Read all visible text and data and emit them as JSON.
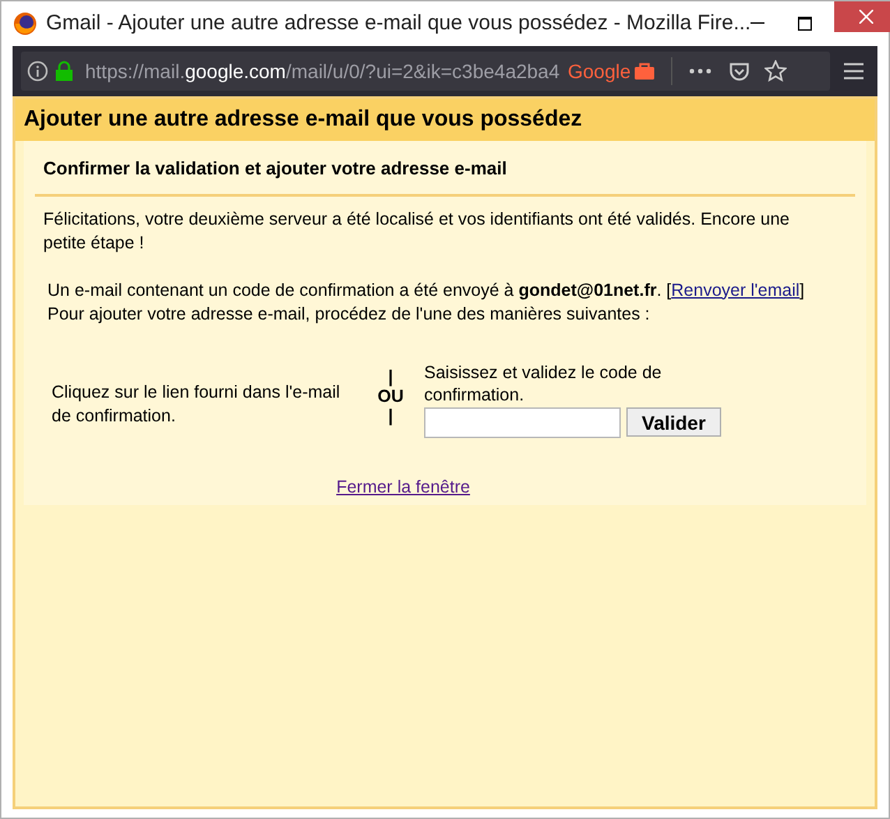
{
  "window": {
    "title": "Gmail - Ajouter une autre adresse e-mail que vous possédez - Mozilla Fire..."
  },
  "toolbar": {
    "url_prefix": "https://mail.",
    "url_domain": "google.com",
    "url_rest": "/mail/u/0/?ui=2&ik=c3be4a2ba4",
    "container_label": "Google"
  },
  "page": {
    "heading": "Ajouter une autre adresse e-mail que vous possédez",
    "subheading": "Confirmer la validation et ajouter votre adresse e-mail",
    "intro": "Félicitations, votre deuxième serveur a été localisé et vos identifiants ont été validés. Encore une petite étape !",
    "sent": {
      "before": "Un e-mail contenant un code de confirmation a été envoyé à **gondet@01net.fr**. [",
      "link": "Renvoyer l'email",
      "after": "]"
    },
    "instructions": "Pour ajouter votre adresse e-mail, procédez de l'une des manières suivantes :",
    "option_link": "Cliquez sur le lien fourni dans l'e-mail de confirmation.",
    "separator": {
      "top": "|",
      "label": "OU",
      "bottom": "|"
    },
    "option_code": "Saisissez et validez le code de confirmation.",
    "validate_button": "Valider",
    "close_link": "Fermer la fenêtre"
  }
}
